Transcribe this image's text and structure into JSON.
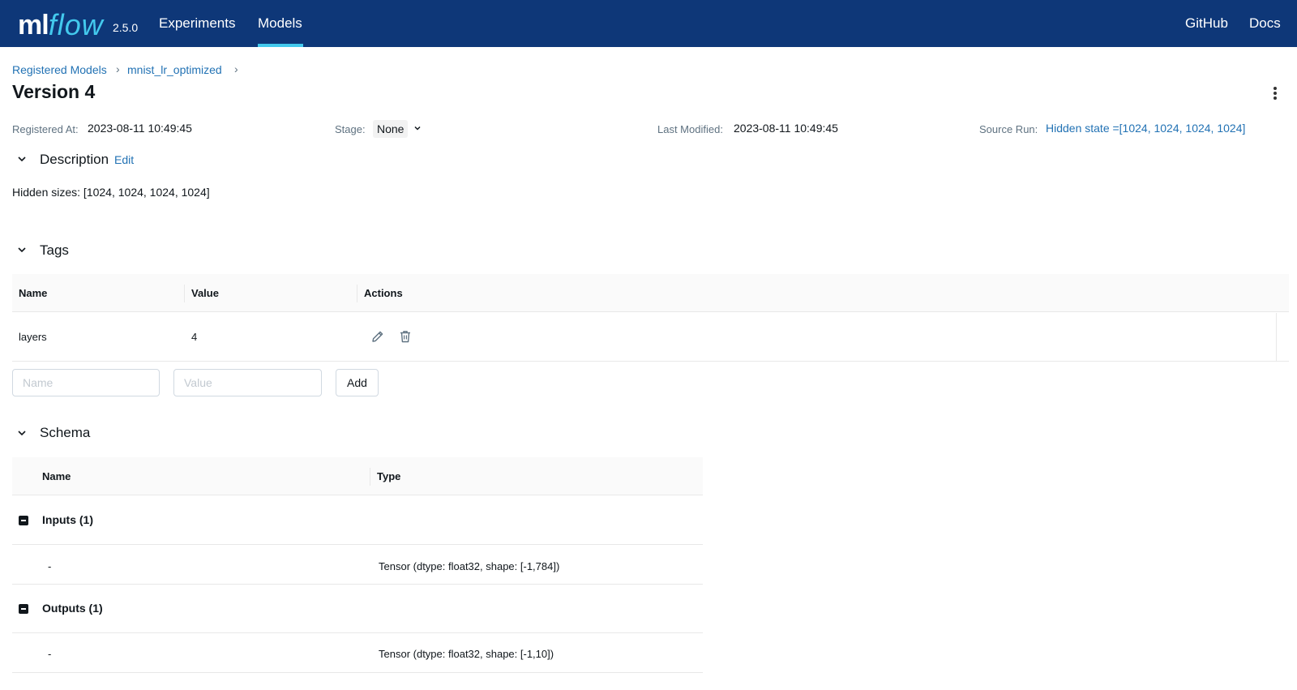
{
  "topnav": {
    "logo_ml": "ml",
    "logo_flow": "flow",
    "version": "2.5.0",
    "links": [
      "Experiments",
      "Models"
    ],
    "active_link": "Models",
    "right_links": [
      "GitHub",
      "Docs"
    ],
    "accent_color": "#43c9ed",
    "bg_color": "#0e3778"
  },
  "breadcrumb": {
    "items": [
      "Registered Models",
      "mnist_lr_optimized"
    ],
    "separator": "›"
  },
  "page": {
    "title": "Version 4",
    "menu_icon": "kebab-menu-icon"
  },
  "meta": {
    "registered_at_label": "Registered At:",
    "registered_at_value": "2023-08-11 10:49:45",
    "stage_label": "Stage:",
    "stage_value": "None",
    "last_modified_label": "Last Modified:",
    "last_modified_value": "2023-08-11 10:49:45",
    "source_run_label": "Source Run:",
    "source_run_value": "Hidden state =[1024, 1024, 1024, 1024]"
  },
  "description": {
    "title": "Description",
    "edit_label": "Edit",
    "text": "Hidden sizes: [1024, 1024, 1024, 1024]"
  },
  "tags": {
    "title": "Tags",
    "columns": [
      "Name",
      "Value",
      "Actions"
    ],
    "rows": [
      {
        "name": "layers",
        "value": "4"
      }
    ],
    "name_placeholder": "Name",
    "value_placeholder": "Value",
    "add_label": "Add"
  },
  "schema": {
    "title": "Schema",
    "columns": [
      "Name",
      "Type"
    ],
    "inputs_label": "Inputs (1)",
    "inputs": [
      {
        "name": "-",
        "type": "Tensor (dtype: float32, shape: [-1,784])"
      }
    ],
    "outputs_label": "Outputs (1)",
    "outputs": [
      {
        "name": "-",
        "type": "Tensor (dtype: float32, shape: [-1,10])"
      }
    ]
  }
}
